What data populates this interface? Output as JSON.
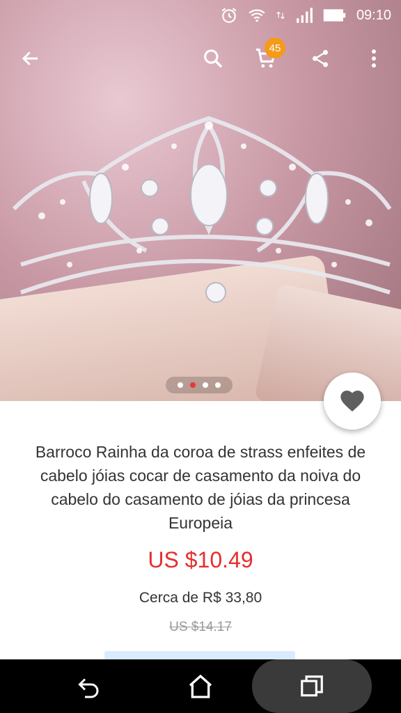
{
  "status_bar": {
    "time": "09:10"
  },
  "toolbar": {
    "cart_count": "45"
  },
  "gallery": {
    "image_count": 4,
    "active_index": 1
  },
  "product": {
    "title": "Barroco Rainha da coroa de strass enfeites de cabelo jóias cocar de casamento da noiva do cabelo do casamento de jóias da princesa Europeia",
    "price": "US $10.49",
    "approx_price": "Cerca de R$ 33,80",
    "original_price": "US $14.17"
  },
  "colors": {
    "price_red": "#e62e2e",
    "badge_orange": "#f59a1a",
    "dot_active": "#e53935"
  }
}
